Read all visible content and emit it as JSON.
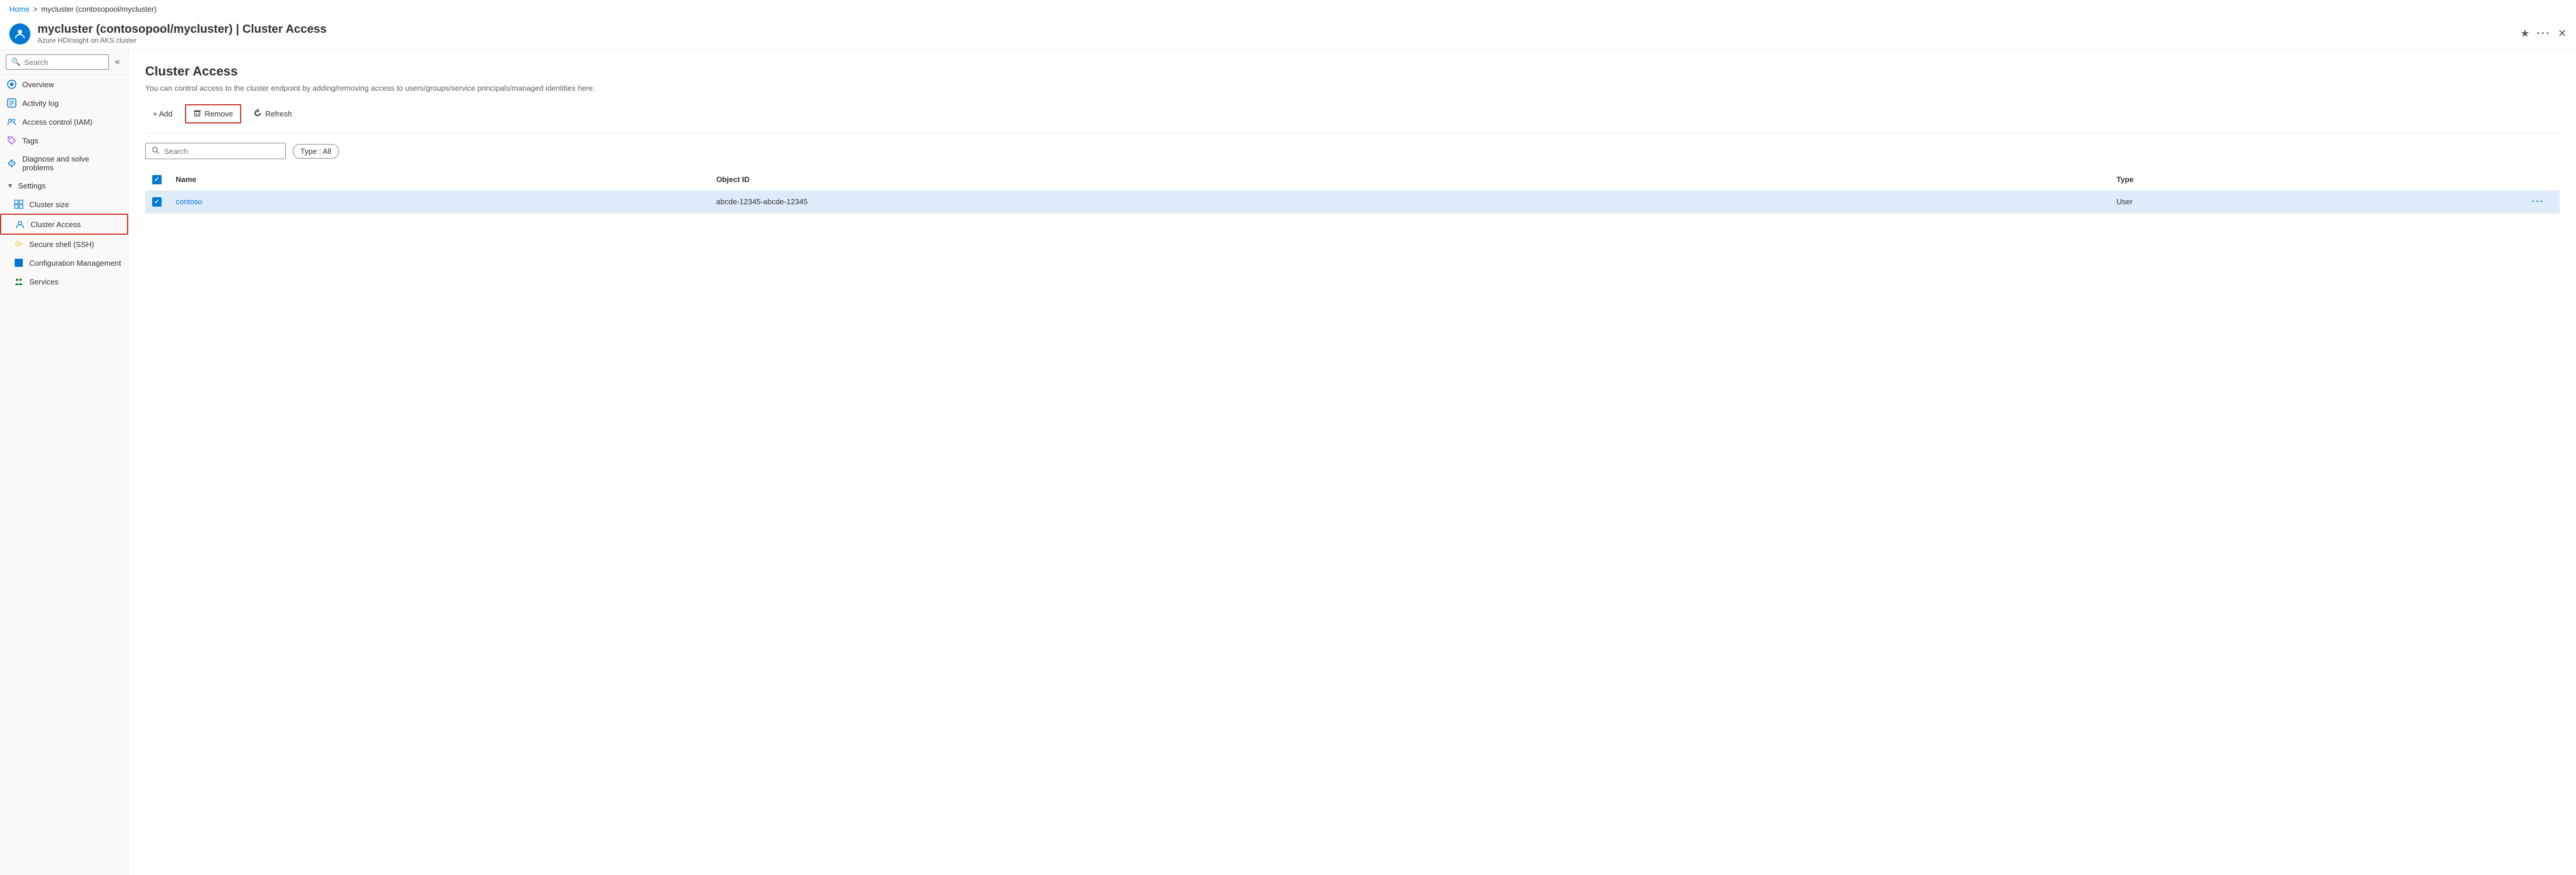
{
  "breadcrumb": {
    "home": "Home",
    "separator": ">",
    "current": "mycluster (contosopool/mycluster)"
  },
  "header": {
    "title": "mycluster (contosopool/mycluster) | Cluster Access",
    "subtitle": "Azure HDInsight on AKS cluster",
    "star_label": "★",
    "dots_label": "···",
    "close_label": "✕"
  },
  "sidebar": {
    "search_placeholder": "Search",
    "collapse_icon": "«",
    "items": [
      {
        "id": "overview",
        "label": "Overview"
      },
      {
        "id": "activity-log",
        "label": "Activity log"
      },
      {
        "id": "access-control",
        "label": "Access control (IAM)"
      },
      {
        "id": "tags",
        "label": "Tags"
      },
      {
        "id": "diagnose",
        "label": "Diagnose and solve problems"
      },
      {
        "id": "settings-header",
        "label": "Settings",
        "type": "section"
      },
      {
        "id": "cluster-size",
        "label": "Cluster size"
      },
      {
        "id": "cluster-access",
        "label": "Cluster Access",
        "active": true
      },
      {
        "id": "secure-shell",
        "label": "Secure shell (SSH)"
      },
      {
        "id": "config-mgmt",
        "label": "Configuration Management"
      },
      {
        "id": "services",
        "label": "Services"
      }
    ]
  },
  "content": {
    "title": "Cluster Access",
    "description": "You can control access to the cluster endpoint by adding/removing access to users/groups/service principals/managed identities here.",
    "toolbar": {
      "add_label": "+ Add",
      "remove_label": "Remove",
      "refresh_label": "Refresh"
    },
    "filter": {
      "search_placeholder": "Search",
      "type_filter_label": "Type : All"
    },
    "table": {
      "columns": [
        "",
        "Name",
        "Object ID",
        "Type",
        ""
      ],
      "rows": [
        {
          "selected": true,
          "name": "contoso",
          "object_id": "abcde-12345-abcde-12345",
          "type": "User"
        }
      ]
    }
  },
  "icons": {
    "search": "🔍",
    "overview": "⊙",
    "activity": "📋",
    "iam": "👥",
    "tags": "🏷",
    "diagnose": "🔧",
    "cluster_size": "📐",
    "cluster_access": "👥",
    "secure_shell": "🔑",
    "config": "⬛",
    "services": "👤",
    "remove": "🗑",
    "refresh": "↻",
    "checkbox_check": "✓"
  }
}
